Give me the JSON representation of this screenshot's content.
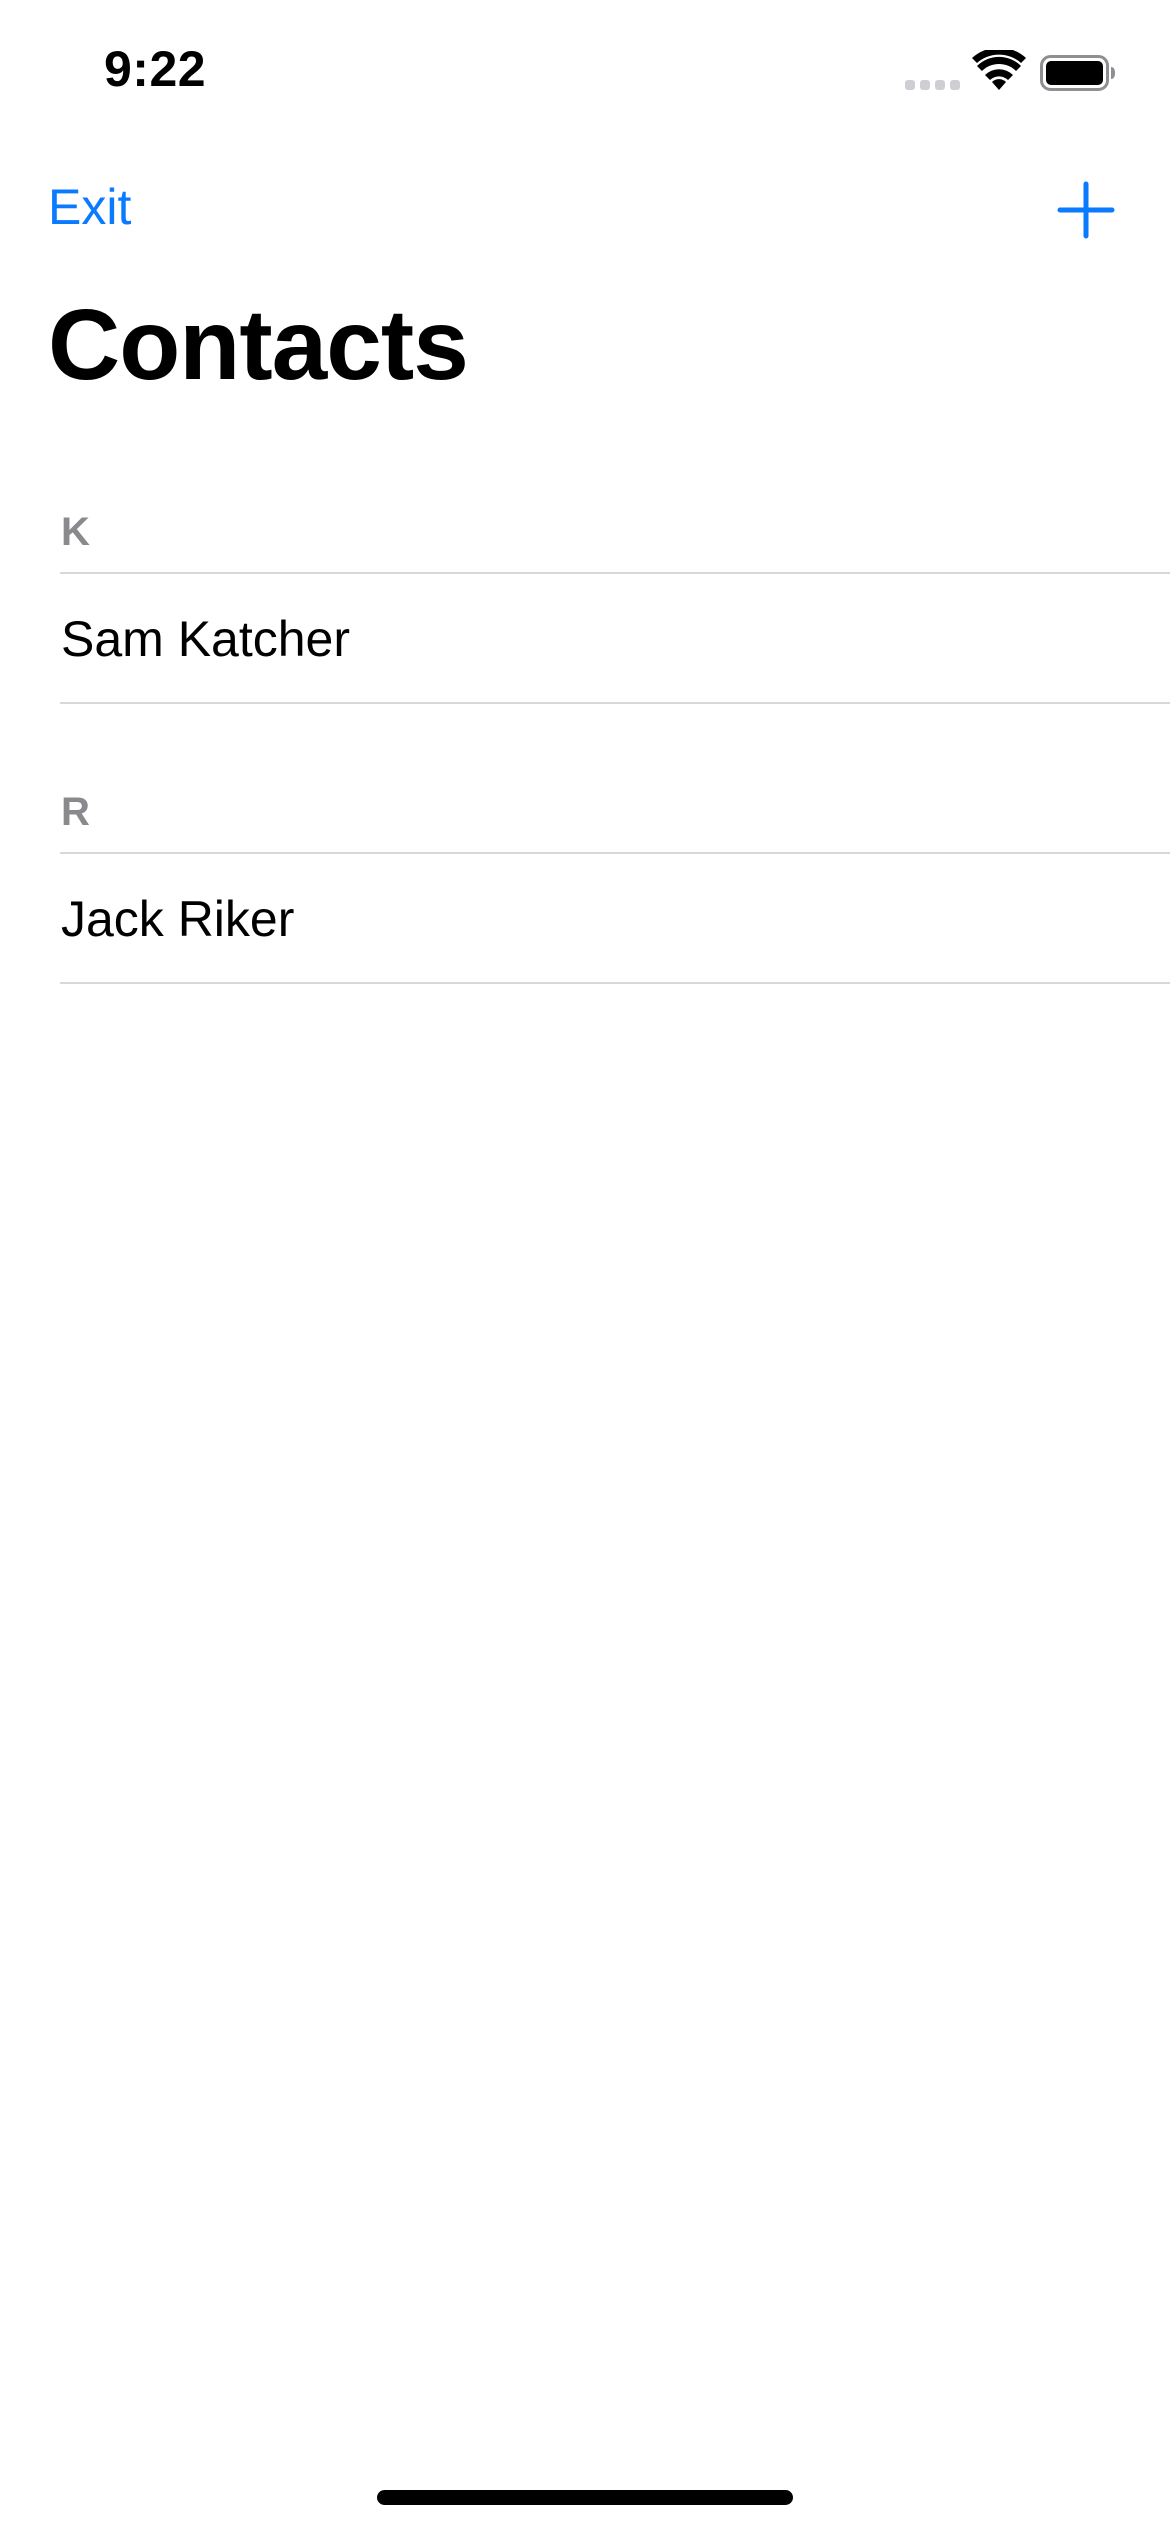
{
  "status_bar": {
    "time": "9:22",
    "icons": [
      "cellular-signal-icon",
      "wifi-icon",
      "battery-icon"
    ]
  },
  "nav": {
    "left_button": "Exit",
    "right_button_icon": "plus-icon"
  },
  "title": "Contacts",
  "sections": [
    {
      "header": "K",
      "contacts": [
        "Sam Katcher"
      ]
    },
    {
      "header": "R",
      "contacts": [
        "Jack Riker"
      ]
    }
  ],
  "colors": {
    "accent": "#0a7aff",
    "section_header": "#8a8a8e",
    "separator": "#d8d8dc",
    "background": "#ffffff"
  }
}
